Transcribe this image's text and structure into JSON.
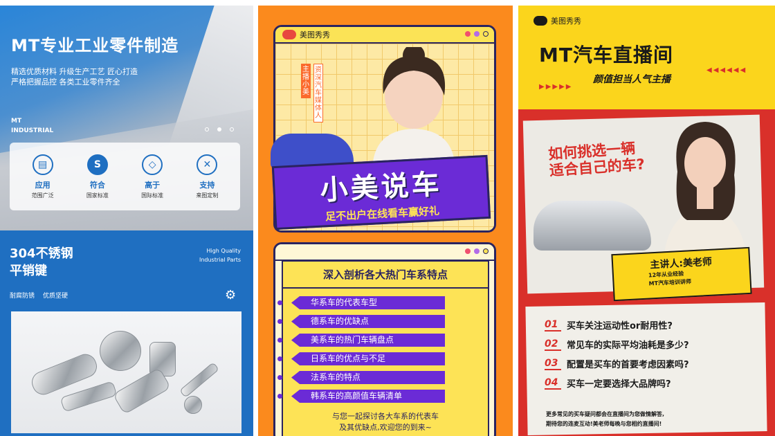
{
  "panel1": {
    "title": "MT专业工业零件制造",
    "subtitle_lines": [
      "精选优质材料 升级生产工艺 匠心打造",
      "严格把握品控 各类工业零件齐全"
    ],
    "brand_lines": [
      "MT",
      "INDUSTRIAL"
    ],
    "features": [
      {
        "icon": "document-icon",
        "label": "应用",
        "sub": "范围广泛"
      },
      {
        "icon": "s-badge-icon",
        "label": "符合",
        "sub": "国家标准"
      },
      {
        "icon": "diamond-icon",
        "label": "高于",
        "sub": "国际标准"
      },
      {
        "icon": "tools-icon",
        "label": "支持",
        "sub": "来图定制"
      }
    ],
    "product_title_lines": [
      "304不锈钢",
      "平销键"
    ],
    "hq_lines": [
      "High Quality",
      "Industrial Parts"
    ],
    "tags": [
      "耐腐防锈",
      "优质坚硬"
    ],
    "colors": {
      "primary": "#1f6fc1"
    }
  },
  "panel2": {
    "logo": "美图秀秀",
    "host_tag": "主播小美",
    "host_desc": "资深汽车媒体人",
    "banner_title": "小美说车",
    "banner_sub": "足不出户在线看车赢好礼",
    "section_title": "深入剖析各大热门车系特点",
    "items": [
      "华系车的代表车型",
      "德系车的优缺点",
      "美系车的热门车辆盘点",
      "日系车的优点与不足",
      "法系车的特点",
      "韩系车的高颜值车辆清单"
    ],
    "footer_lines": [
      "与您一起探讨各大车系的代表车",
      "及其优缺点,欢迎您的到来~"
    ],
    "colors": {
      "orange": "#fb8a1d",
      "purple": "#6b2bd6",
      "yellow": "#fde356"
    }
  },
  "panel3": {
    "logo": "美图秀秀",
    "title": "MT汽车直播间",
    "subtitle": "颜值担当人气主播",
    "question_lines": [
      "如何挑选一辆",
      "适合自己的车?"
    ],
    "speaker": "主讲人:美老师",
    "speaker_info": [
      "12年从业经验",
      "MT汽车培训讲师"
    ],
    "questions": [
      {
        "num": "01",
        "text": "买车关注运动性or耐用性?"
      },
      {
        "num": "02",
        "text": "常见车的实际平均油耗是多少?"
      },
      {
        "num": "03",
        "text": "配置是买车的首要考虑因素吗?"
      },
      {
        "num": "04",
        "text": "买车一定要选择大品牌吗?"
      }
    ],
    "footer_lines": [
      "更多常见的买车疑问都会在直播间为您做情解答,",
      "期待您的连麦互动!美老师每晚与您相约直播间!"
    ],
    "colors": {
      "red": "#d9302a",
      "yellow": "#fbd51c"
    }
  }
}
